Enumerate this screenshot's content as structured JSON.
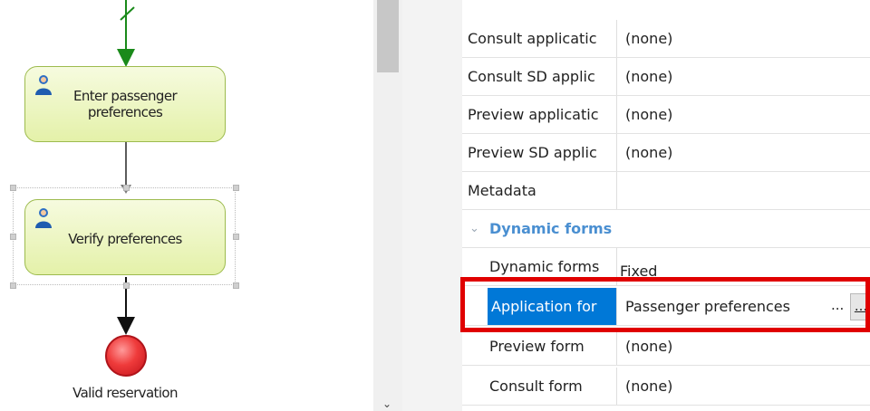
{
  "diagram": {
    "tasks": [
      {
        "label_line1": "Enter passenger",
        "label_line2": "preferences"
      },
      {
        "label": "Verify preferences"
      }
    ],
    "end_event": {
      "label": "Valid reservation"
    },
    "icons": {
      "task_icon": "user-icon"
    }
  },
  "properties": {
    "rows": [
      {
        "name": "Consult applicatic",
        "value": "(none)"
      },
      {
        "name": "Consult SD applic",
        "value": "(none)"
      },
      {
        "name": "Preview applicatic",
        "value": "(none)"
      },
      {
        "name": "Preview SD applic",
        "value": "(none)"
      },
      {
        "name": "Metadata",
        "value": ""
      }
    ],
    "category": {
      "label": "Dynamic forms",
      "chevron": "⌄"
    },
    "sub_rows": [
      {
        "name": "Dynamic forms",
        "value": "Fixed"
      },
      {
        "name": "Application for",
        "value": "Passenger preferences",
        "ellipsis": "...",
        "button": "..."
      },
      {
        "name": "Preview form",
        "value": "(none)"
      },
      {
        "name": "Consult form",
        "value": "(none)"
      }
    ]
  },
  "scrollbar": {
    "down_arrow": "⌄"
  },
  "colors": {
    "selection": "#0078d7",
    "highlight": "#e00000",
    "category": "#4a8fd1",
    "task_fill": "#e4f1a9"
  }
}
